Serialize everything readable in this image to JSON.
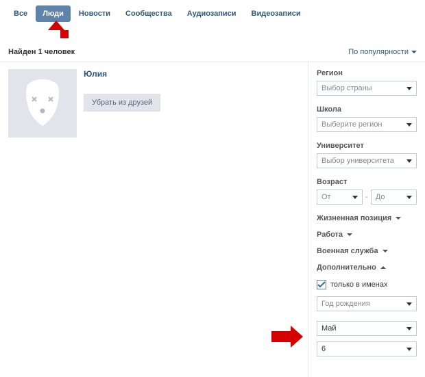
{
  "tabs": {
    "all": "Все",
    "people": "Люди",
    "news": "Новости",
    "communities": "Сообщества",
    "audio": "Аудиозаписи",
    "video": "Видеозаписи"
  },
  "results": {
    "found_text": "Найден 1 человек",
    "sort_label": "По популярности"
  },
  "person": {
    "name": "Юлия",
    "remove_button": "Убрать из друзей"
  },
  "filters": {
    "region": {
      "label": "Регион",
      "value": "Выбор страны"
    },
    "school": {
      "label": "Школа",
      "value": "Выберите регион"
    },
    "university": {
      "label": "Университет",
      "value": "Выбор университета"
    },
    "age": {
      "label": "Возраст",
      "from": "От",
      "to": "До",
      "sep": "-"
    },
    "life_stance": "Жизненная позиция",
    "work": "Работа",
    "military": "Военная служба",
    "additional": {
      "label": "Дополнительно",
      "only_names": "только в именах",
      "birth_year": "Год рождения",
      "month": "Май",
      "day": "6"
    }
  }
}
